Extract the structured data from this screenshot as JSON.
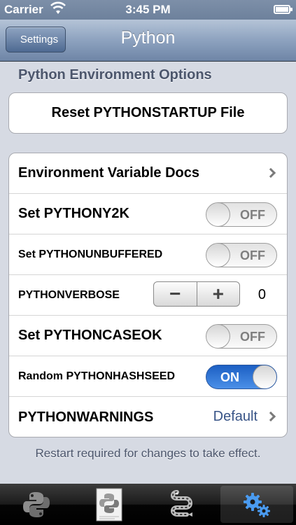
{
  "status_bar": {
    "carrier": "Carrier",
    "time": "3:45 PM"
  },
  "nav": {
    "back_label": "Settings",
    "title": "Python"
  },
  "section": {
    "header": "Python Environment Options"
  },
  "reset_button": {
    "label": "Reset PYTHONSTARTUP File"
  },
  "rows": {
    "env_docs": {
      "label": "Environment Variable Docs"
    },
    "pythony2k": {
      "label": "Set PYTHONY2K",
      "state": "OFF"
    },
    "pythonunbuffered": {
      "label": "Set PYTHONUNBUFFERED",
      "state": "OFF"
    },
    "pythonverbose": {
      "label": "PYTHONVERBOSE",
      "minus": "−",
      "plus": "+",
      "value": "0"
    },
    "pythoncaseok": {
      "label": "Set PYTHONCASEOK",
      "state": "OFF"
    },
    "pythonhashseed": {
      "label": "Random PYTHONHASHSEED",
      "state": "ON"
    },
    "pythonwarnings": {
      "label": "PYTHONWARNINGS",
      "value": "Default"
    }
  },
  "footer_note": "Restart required for changes to take effect.",
  "tabs": [
    {
      "icon": "python-logo-icon",
      "active": false
    },
    {
      "icon": "script-document-icon",
      "active": false
    },
    {
      "icon": "snake-icon",
      "active": false
    },
    {
      "icon": "gears-icon",
      "active": true
    }
  ],
  "colors": {
    "accent_blue": "#2f6fd6",
    "detail_value": "#385487",
    "background": "#d6dae3"
  }
}
